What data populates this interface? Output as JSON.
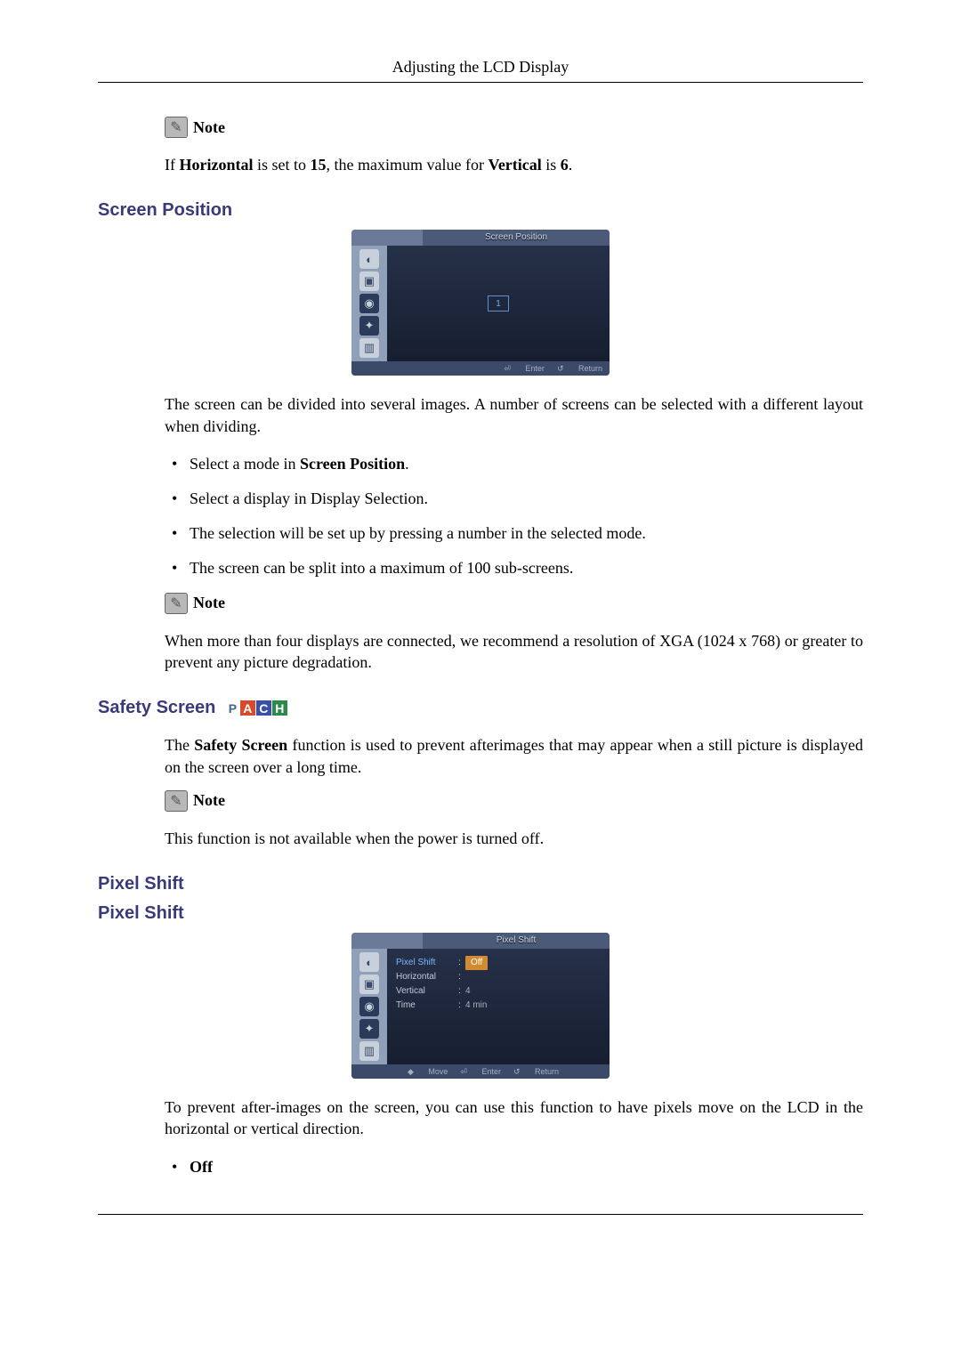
{
  "header": "Adjusting the LCD Display",
  "note_label": "Note",
  "note1_pre": "If ",
  "note1_b1": "Horizontal",
  "note1_mid": " is set to ",
  "note1_b2": "15",
  "note1_mid2": ", the maximum value for ",
  "note1_b3": "Vertical",
  "note1_mid3": " is ",
  "note1_b4": "6",
  "note1_end": ".",
  "screen_position": {
    "title": "Screen Position",
    "osd_title": "Screen Position",
    "center_value": "1",
    "footer_enter": "Enter",
    "footer_return": "Return",
    "para": "The screen can be divided into several images. A number of screens can be selected with a different layout when dividing.",
    "li1_a": "Select a mode in ",
    "li1_b": "Screen Position",
    "li1_c": ".",
    "li2": "Select a display in Display Selection.",
    "li3": "The selection will be set up by pressing a number in the selected mode.",
    "li4": "The screen can be split into a maximum of 100 sub-screens.",
    "note2": "When more than four displays are connected, we recommend a resolution of XGA (1024 x 768) or greater to prevent any picture degradation."
  },
  "safety_screen": {
    "title": "Safety Screen",
    "badges": {
      "p": "P",
      "a": "A",
      "c": "C",
      "h": "H"
    },
    "para_a": "The ",
    "para_b": "Safety Screen",
    "para_c": " function is used to prevent afterimages that may appear when a still picture is displayed on the screen over a long time.",
    "note": "This function is not available when the power is turned off."
  },
  "pixel_shift": {
    "title1": "Pixel Shift",
    "title2": "Pixel Shift",
    "osd_title": "Pixel Shift",
    "rows": {
      "r1_label": "Pixel Shift",
      "r1_value": "Off",
      "r2_label": "Horizontal",
      "r2_value": "",
      "r3_label": "Vertical",
      "r3_value": "4",
      "r4_label": "Time",
      "r4_value": "4 min"
    },
    "footer_move": "Move",
    "footer_enter": "Enter",
    "footer_return": "Return",
    "para": "To prevent after-images on the screen, you can use this function to have pixels move on the LCD in the horizontal or vertical direction.",
    "li_off": "Off"
  }
}
